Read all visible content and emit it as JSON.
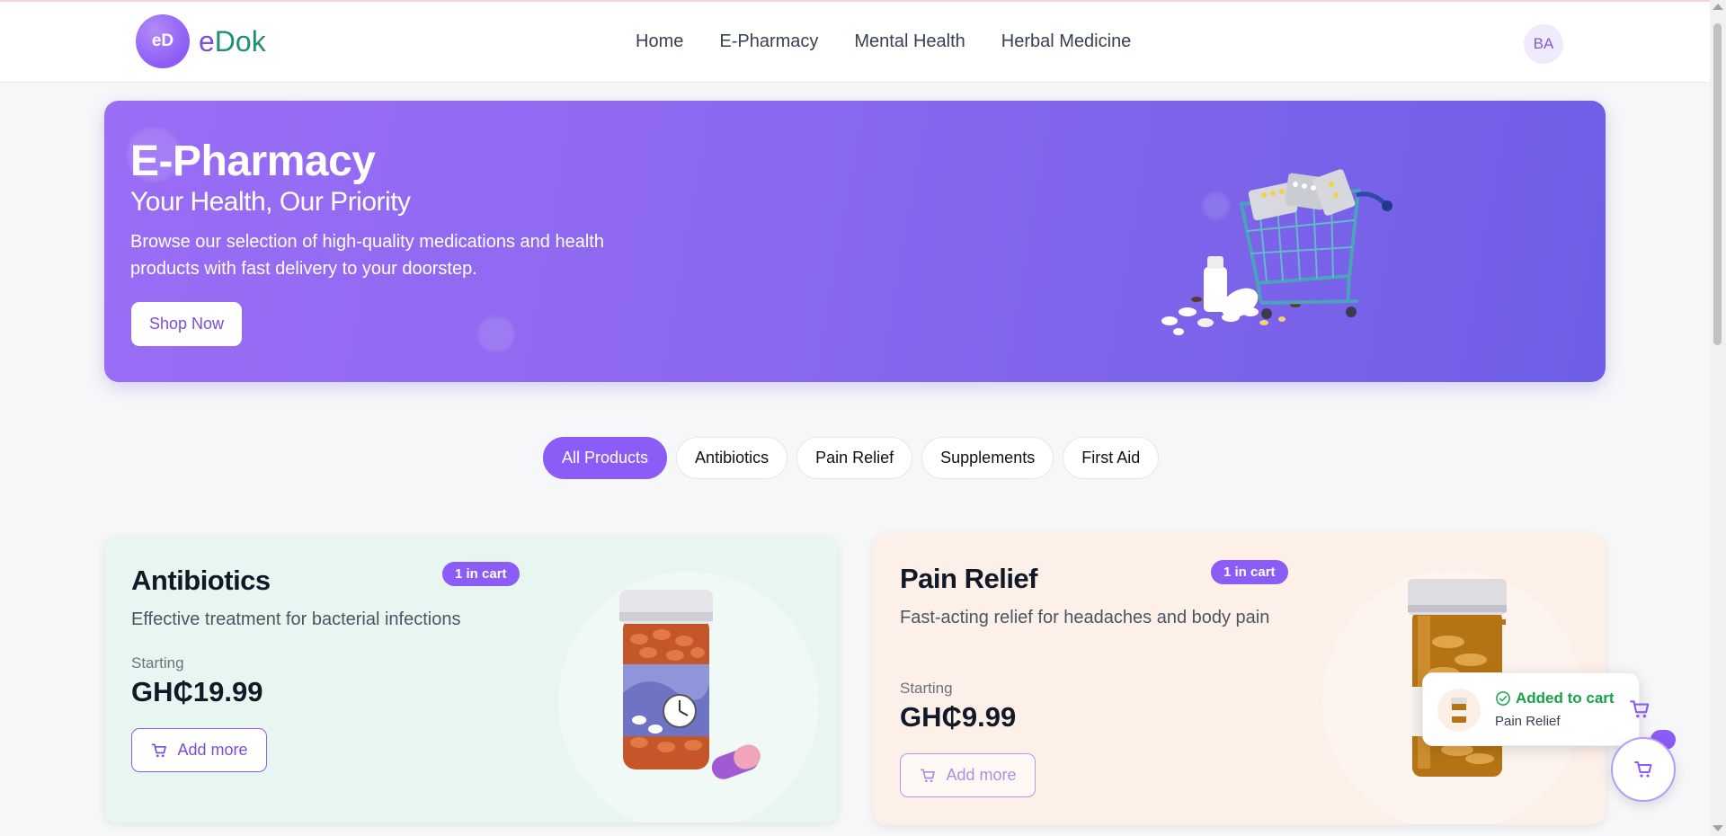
{
  "header": {
    "logo_badge": "eD",
    "logo_text_e": "e",
    "logo_text_rest": "Dok",
    "nav": [
      "Home",
      "E-Pharmacy",
      "Mental Health",
      "Herbal Medicine"
    ],
    "avatar_initials": "BA"
  },
  "hero": {
    "title": "E-Pharmacy",
    "subtitle": "Your Health, Our Priority",
    "description": "Browse our selection of high-quality medications and health products with fast delivery to your doorstep.",
    "cta_label": "Shop Now",
    "image_icon": "shopping-cart-with-pills"
  },
  "filters": {
    "chips": [
      "All Products",
      "Antibiotics",
      "Pain Relief",
      "Supplements",
      "First Aid"
    ],
    "active": "All Products"
  },
  "products": [
    {
      "title": "Antibiotics",
      "description": "Effective treatment for bacterial infections",
      "starting_label": "Starting",
      "price": "GH₵19.99",
      "badge": "1 in cart",
      "button_label": "Add more",
      "bg_color": "#e8f6f1",
      "image_icon": "pill-bottle"
    },
    {
      "title": "Pain Relief",
      "description": "Fast-acting relief for headaches and body pain",
      "starting_label": "Starting",
      "price": "GH₵9.99",
      "badge": "1 in cart",
      "button_label": "Add more",
      "bg_color": "#fdf0e8",
      "image_icon": "amber-pill-bottle"
    }
  ],
  "toast": {
    "title": "Added to cart",
    "item": "Pain Relief"
  },
  "colors": {
    "accent": "#8b5cf6",
    "success": "#16a34a"
  }
}
